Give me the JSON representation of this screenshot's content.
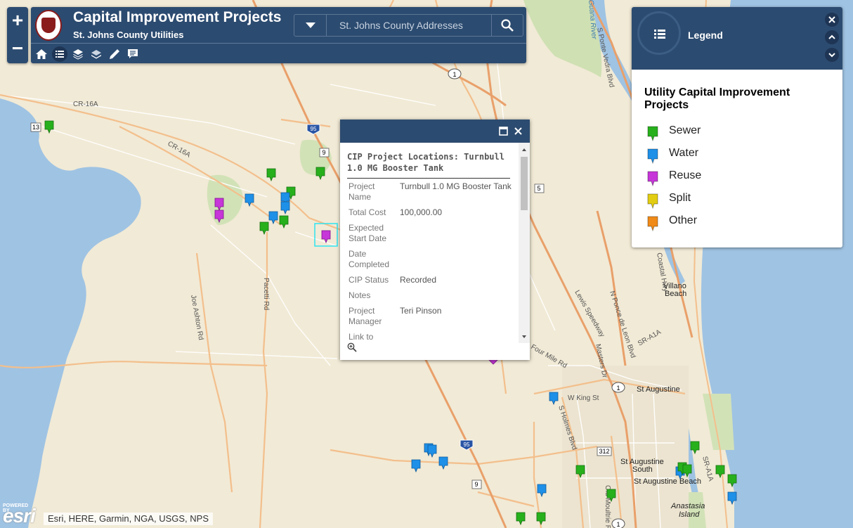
{
  "app": {
    "title": "Capital Improvement Projects",
    "subtitle": "St. Johns County Utilities"
  },
  "zoom": {
    "in": "+",
    "out": "−"
  },
  "search": {
    "placeholder": "St. Johns County Addresses"
  },
  "toolbar": [
    "home-icon",
    "list-icon",
    "layers-icon",
    "basemap-icon",
    "measure-icon",
    "about-icon"
  ],
  "legend": {
    "header": "Legend",
    "section": "Utility Capital Improvement Projects",
    "items": [
      {
        "label": "Sewer",
        "color": "#27b01c"
      },
      {
        "label": "Water",
        "color": "#1e90e8"
      },
      {
        "label": "Reuse",
        "color": "#c636d8"
      },
      {
        "label": "Split",
        "color": "#e2cd12"
      },
      {
        "label": "Other",
        "color": "#f08a18"
      }
    ]
  },
  "popup": {
    "title": "CIP Project Locations: Turnbull 1.0 MG Booster Tank",
    "fields": [
      {
        "label": "Project Name",
        "value": "Turnbull 1.0 MG Booster Tank"
      },
      {
        "label": "Total Cost",
        "value": "100,000.00"
      },
      {
        "label": "Expected Start Date",
        "value": ""
      },
      {
        "label": "Date Completed",
        "value": ""
      },
      {
        "label": "CIP Status",
        "value": "Recorded"
      },
      {
        "label": "Notes",
        "value": ""
      },
      {
        "label": "Project Manager",
        "value": "Teri Pinson"
      },
      {
        "label": "Link to",
        "value": ""
      }
    ]
  },
  "map": {
    "places": [
      "Villano",
      "Beach",
      "St Augustine",
      "St Augustine",
      "South",
      "St Augustine Beach",
      "Anastasia",
      "Island"
    ],
    "roads": [
      "CR-16A",
      "CR-16A",
      "Pacetti Rd",
      "Joe Ashton Rd",
      "W King St",
      "S Holmes Blvd",
      "Masters Dr",
      "N Ponce de Leon Blvd",
      "SR-A1A",
      "Lewis Speedway",
      "Coastal Hwy",
      "S Ponte Vedra Blvd",
      "Four Mile Rd",
      "Old Moultrie Rd",
      "SR-A1A"
    ],
    "shields": [
      "13",
      "95",
      "9",
      "1",
      "5",
      "1",
      "95",
      "9",
      "312",
      "1"
    ],
    "water": [
      "Guana River"
    ]
  },
  "attribution": {
    "powered": "POWERED BY",
    "logo": "esri",
    "credit": "Esri, HERE, Garmin, NGA, USGS, NPS"
  }
}
